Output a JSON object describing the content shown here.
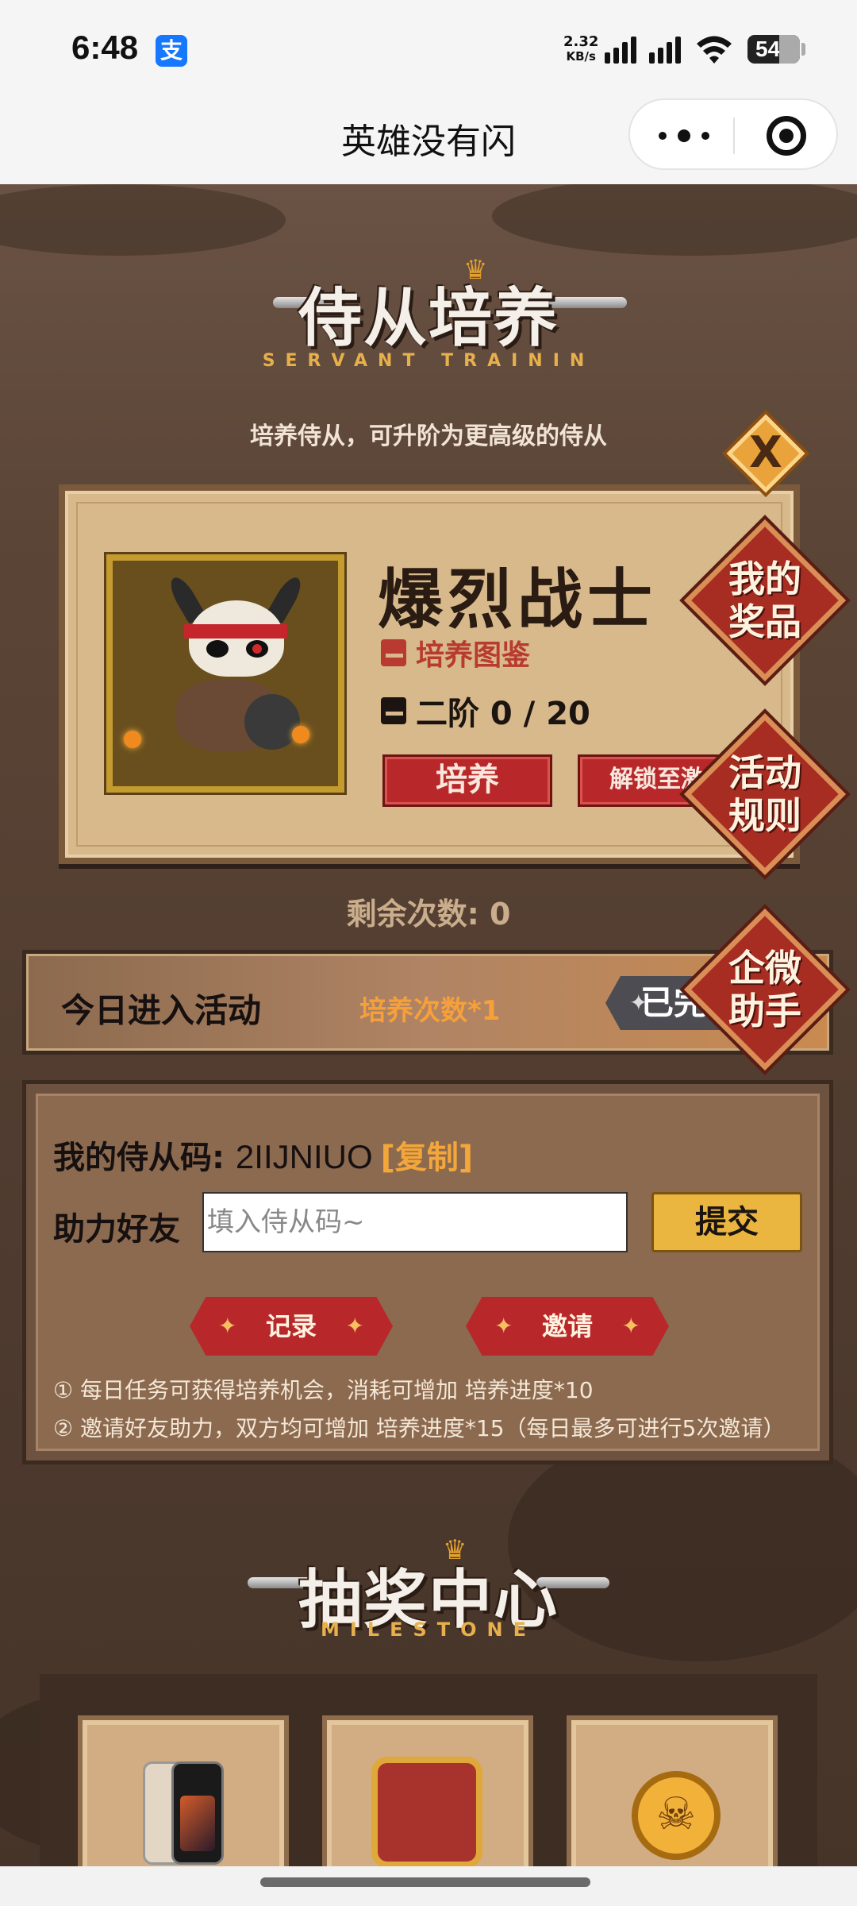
{
  "status_bar": {
    "time": "6:48",
    "alipay_glyph": "支",
    "net_speed": "2.32",
    "net_unit": "KB/s",
    "battery": "54"
  },
  "title_bar": {
    "title": "英雄没有闪",
    "more_icon": "more-dots-icon",
    "close_icon": "target-circle-icon"
  },
  "servant_training": {
    "title": "侍从培养",
    "subtitle": "SERVANT TRAININ",
    "tagline": "培养侍从，可升阶为更高级的侍从",
    "close_glyph": "X",
    "servant_name": "爆烈战士",
    "codex_label": "培养图鉴",
    "tier_text": "二阶 0 / 20",
    "train_button": "培养",
    "unlock_button": "解锁至激",
    "remaining": "剩余次数: 0"
  },
  "side_buttons": {
    "my_prizes": "我的奖品",
    "activity_rules": "活动规则",
    "wecom_assistant": "企微助手"
  },
  "today_task": {
    "label": "今日进入活动",
    "reward": "培养次数*1",
    "status_button": "已完"
  },
  "invite": {
    "code_label": "我的侍从码: ",
    "code_value": "2IIJNIUO",
    "copy_label": "[复制]",
    "help_label": "助力好友",
    "input_placeholder": "填入侍从码~",
    "submit_button": "提交",
    "record_button": "记录",
    "invite_button": "邀请",
    "rule_1": "① 每日任务可获得培养机会，消耗可增加 培养进度*10",
    "rule_2": "② 邀请好友助力，双方均可增加 培养进度*15（每日最多可进行5次邀请）"
  },
  "lottery": {
    "title": "抽奖中心",
    "subtitle": "MILESTONE",
    "prizes": [
      {
        "icon": "smartphone-icon"
      },
      {
        "icon": "treasure-chest-icon"
      },
      {
        "icon": "skull-coin-icon"
      }
    ]
  },
  "colors": {
    "accent_red": "#b8282b",
    "accent_gold": "#eab640",
    "orange_text": "#f7a03a",
    "card_bg": "#d7b98b"
  }
}
